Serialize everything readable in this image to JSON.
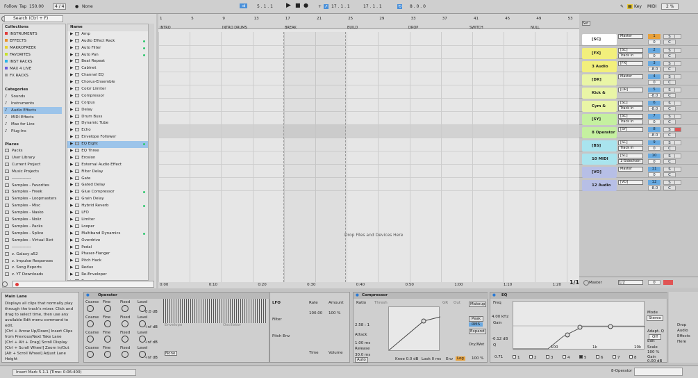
{
  "transport": {
    "follow": "Follow",
    "tap": "Tap",
    "tempo": "150.00",
    "time_sig": "4 / 4",
    "metro": "1 Bar",
    "none": "None",
    "pos": "5 . 1 . 1",
    "loop_start": "17 . 1 . 1",
    "loop_len": "8 . 0 . 0",
    "key": "Key",
    "midi": "MIDI",
    "cpu": "2 %"
  },
  "browser": {
    "search_placeholder": "Search (Ctrl + F)",
    "collections_title": "Collections",
    "collections": [
      {
        "label": "INSTRUMENTS",
        "color": "#e03a3a"
      },
      {
        "label": "EFFECTS",
        "color": "#e8922b"
      },
      {
        "label": "MAKROFREEK",
        "color": "#e8d12b"
      },
      {
        "label": "FAVORITES",
        "color": "#c7e02b"
      },
      {
        "label": "INST RACKS",
        "color": "#2bb5e8"
      },
      {
        "label": "MAX 4 LIVE",
        "color": "#6a5be0"
      },
      {
        "label": "FX RACKS",
        "color": "#9a9a9a"
      }
    ],
    "categories_title": "Categories",
    "categories": [
      "Sounds",
      "Instruments",
      "Audio Effects",
      "MIDI Effects",
      "Max for Live",
      "Plug-Ins"
    ],
    "places_title": "Places",
    "places": [
      "Packs",
      "User Library",
      "Current Project",
      "Music Projects",
      "--------------",
      "Samples - Favorites",
      "Samples - Freek",
      "Samples - Loopmasters",
      "Samples - Misc",
      "Samples - Nasko",
      "Samples - Noiiz",
      "Samples - Packs",
      "Samples - Splice",
      "Samples - Virtual Riot",
      "--------------",
      "z. Galaxy a52",
      "z. Impulse Responses",
      "z. Song Exports",
      "z. YT Downloads"
    ],
    "name_header": "Name",
    "items": [
      "Amp",
      "Audio Effect Rack",
      "Auto Filter",
      "Auto Pan",
      "Beat Repeat",
      "Cabinet",
      "Channel EQ",
      "Chorus-Ensemble",
      "Color Limiter",
      "Compressor",
      "Corpus",
      "Delay",
      "Drum Buss",
      "Dynamic Tube",
      "Echo",
      "Envelope Follower",
      "EQ Eight",
      "EQ Three",
      "Erosion",
      "External Audio Effect",
      "Filter Delay",
      "Gate",
      "Gated Delay",
      "Glue Compressor",
      "Grain Delay",
      "Hybrid Reverb",
      "LFO",
      "Limiter",
      "Looper",
      "Multiband Dynamics",
      "Overdrive",
      "Pedal",
      "Phaser-Flanger",
      "Pitch Hack",
      "Redux",
      "Re-Enveloper",
      "Resonators"
    ]
  },
  "arrangement": {
    "locators": [
      "INTRO",
      "INTRO DRUMS",
      "BREAK",
      "BUILD",
      "DROP",
      "SWITCH",
      "NULL"
    ],
    "bars": [
      "1",
      "5",
      "9",
      "13",
      "17",
      "21",
      "25",
      "29",
      "33",
      "37",
      "41",
      "45",
      "49",
      "53"
    ],
    "drop_hint": "Drop Files and Devices Here",
    "times": [
      "0:00",
      "0:10",
      "0:20",
      "0:30",
      "0:40",
      "0:50",
      "1:00",
      "1:10",
      "1:20"
    ],
    "zoom": "1/1"
  },
  "tracks": [
    {
      "name": "[SC]",
      "color": "#ffffff",
      "route": "Master",
      "num": "1",
      "vol": "0",
      "h": 20
    },
    {
      "name": "[FX]",
      "color": "#f2ef7c",
      "route": "[SC]",
      "route2": "Track In",
      "num": "2",
      "vol": "0",
      "h": 19
    },
    {
      "name": "3 Audio",
      "color": "#f2ef7c",
      "route": "[FX]",
      "num": "3",
      "vol": "-8.0",
      "h": 19
    },
    {
      "name": "[DR]",
      "color": "#e9f5a6",
      "route": "Master",
      "num": "4",
      "vol": "0",
      "h": 19
    },
    {
      "name": "Kick & Snare",
      "color": "#e9f5a6",
      "route": "[DR]",
      "num": "5",
      "vol": "-8.0",
      "h": 19
    },
    {
      "name": "Cym & Percs",
      "color": "#e9f5a6",
      "route": "[SC]",
      "route2": "Track In",
      "num": "6",
      "vol": "-8.0",
      "h": 19
    },
    {
      "name": "[SY]",
      "color": "#c5f0a0",
      "route": "[SC]",
      "route2": "Track In",
      "num": "7",
      "vol": "0",
      "h": 19
    },
    {
      "name": "8 Operator",
      "color": "#c5f0a0",
      "route": "[SY]",
      "num": "8",
      "vol": "-8.0",
      "h": 19
    },
    {
      "name": "[BS]",
      "color": "#a9e4ee",
      "route": "[SC]",
      "route2": "Track In",
      "num": "9",
      "vol": "0",
      "h": 19
    },
    {
      "name": "10 MIDI",
      "color": "#a9e4ee",
      "route": "[SC]",
      "route2": "1-Sidechain",
      "num": "10",
      "vol": "0",
      "h": 19
    },
    {
      "name": "[VO]",
      "color": "#b7bfe6",
      "route": "Master",
      "num": "11",
      "vol": "0",
      "h": 19
    },
    {
      "name": "12 Audio",
      "color": "#b7bfe6",
      "route": "[VO]",
      "num": "12",
      "vol": "-8.0",
      "h": 19
    }
  ],
  "master": {
    "name": "Master",
    "route": "1/2",
    "vol": "0"
  },
  "info": {
    "title": "Main Lane",
    "text": "Displays all clips that normally play through the track's mixer. Click and drag to select time, then use any available Edit menu command to edit.",
    "shortcuts": [
      "[Ctrl + Arrow Up/Down] Insert Clips from Previous/Next Take Lane",
      "[Ctrl + Alt + Drag] Scroll Display",
      "[Ctrl + Scroll Wheel] Zoom In/Out",
      "[Alt + Scroll Wheel] Adjust Lane Height"
    ]
  },
  "operator": {
    "title": "Operator",
    "labels": [
      "Coarse",
      "Fine",
      "Fixed",
      "Level"
    ],
    "levels": [
      "0.0 dB",
      "-inf dB",
      "-inf dB",
      "-inf dB"
    ],
    "env": "Envelope",
    "osc": "Oscillator",
    "lfo": "LFO",
    "filter": "Filter",
    "rate": "100.00",
    "amount": "100 %",
    "pitch": "Pitch Env",
    "time": "Time",
    "tone": "Tone",
    "volume": "Volume"
  },
  "compressor": {
    "title": "Compressor",
    "ratio": "2.58 : 1",
    "attack": "1.00 ms",
    "release": "30.0 ms",
    "thresh": "Thresh",
    "gr": "GR",
    "out": "Out",
    "makeup": "Makeup",
    "peak": "Peak",
    "rms": "RMS",
    "expand": "Expand",
    "drywet": "Dry/Wet",
    "drywet_val": "100 %",
    "auto": "Auto",
    "knee": "Knee 0.0 dB",
    "look": "Look 0 ms",
    "env": "Env",
    "log": "Log"
  },
  "eq": {
    "title": "EQ",
    "freq": "4.00 kHz",
    "gain": "-0.12 dB",
    "q": "0.71",
    "mode": "Mode",
    "stereo": "Stereo",
    "adapt": "Adapt. Q",
    "off": "Off",
    "edit": "Edit",
    "scale": "Scale",
    "scale_val": "100 %",
    "gain2": "Gain",
    "gain2_val": "0.00 dB",
    "bands": [
      "1",
      "2",
      "3",
      "4",
      "5",
      "6",
      "7",
      "8"
    ],
    "axis": [
      "100",
      "1k",
      "10k"
    ]
  },
  "drop_audio": "Drop Audio Effects Here",
  "status": {
    "text": "Insert Mark 5.1.1 (Time: 0:06:400)",
    "track": "8-Operator"
  }
}
